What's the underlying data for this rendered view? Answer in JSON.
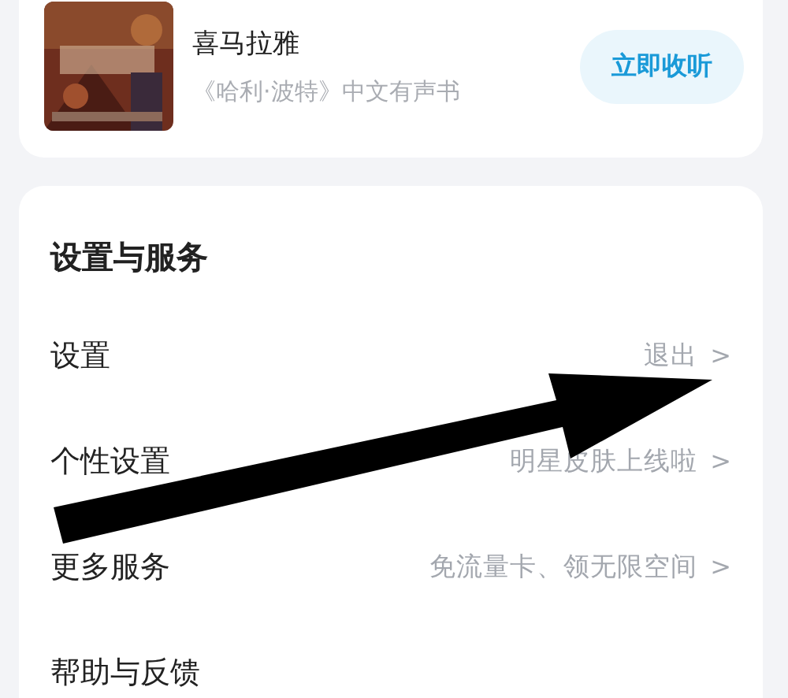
{
  "promo": {
    "kind": "picture",
    "title": "喜马拉雅",
    "subtitle": "《哈利·波特》中文有声书",
    "button": "立即收听"
  },
  "settings": {
    "title": "设置与服务",
    "rows": [
      {
        "label": "设置",
        "hint": "退出",
        "chevron": ">"
      },
      {
        "label": "个性设置",
        "hint": "明星皮肤上线啦",
        "chevron": ">"
      },
      {
        "label": "更多服务",
        "hint": "免流量卡、领无限空间",
        "chevron": ">"
      },
      {
        "label": "帮助与反馈"
      }
    ]
  },
  "annotation": {
    "kind": "arrow"
  }
}
